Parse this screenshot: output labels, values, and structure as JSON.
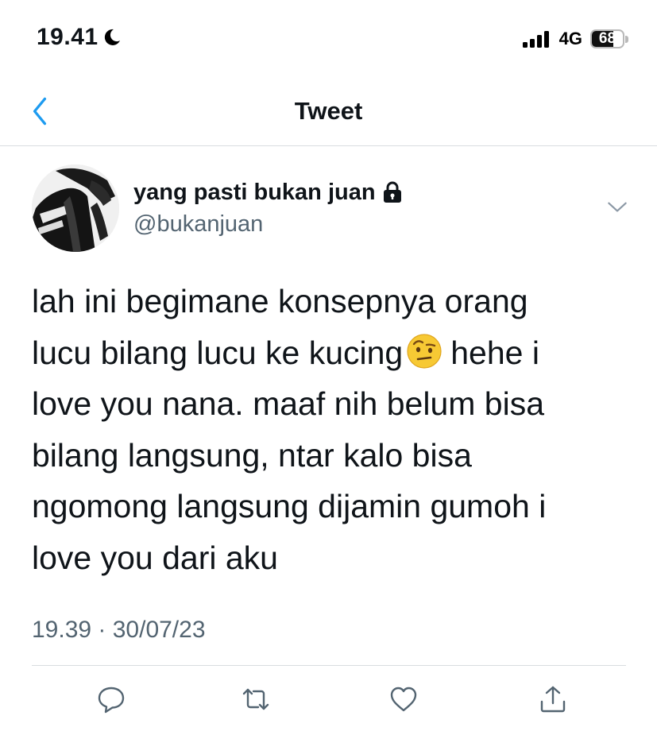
{
  "status_bar": {
    "time": "19.41",
    "network": "4G",
    "battery_percent": "68",
    "battery_level": 0.68,
    "icons": [
      "moon-icon",
      "signal-icon",
      "battery-icon"
    ]
  },
  "header": {
    "title": "Tweet",
    "back_icon": "chevron-left-icon"
  },
  "tweet": {
    "author": {
      "display_name": "yang pasti bukan juan",
      "handle": "@bukanjuan",
      "protected_icon": "lock-icon"
    },
    "text_lines": [
      "lah ini begimane konsepnya orang",
      "lucu bilang lucu ke kucing",
      "hehe i",
      "love you nana. maaf nih belum bisa",
      "bilang langsung, ntar kalo bisa",
      "ngomong langsung dijamin gumoh i",
      "love you dari aku"
    ],
    "emoji_icon": "face-with-raised-eyebrow-emoji",
    "timestamp": "19.39 · 30/07/23"
  },
  "actions": [
    "reply-icon",
    "retweet-icon",
    "like-icon",
    "share-icon"
  ],
  "colors": {
    "accent": "#1d9bf0",
    "text_primary": "#0f1419",
    "text_secondary": "#536471",
    "divider": "#d8dde0"
  }
}
